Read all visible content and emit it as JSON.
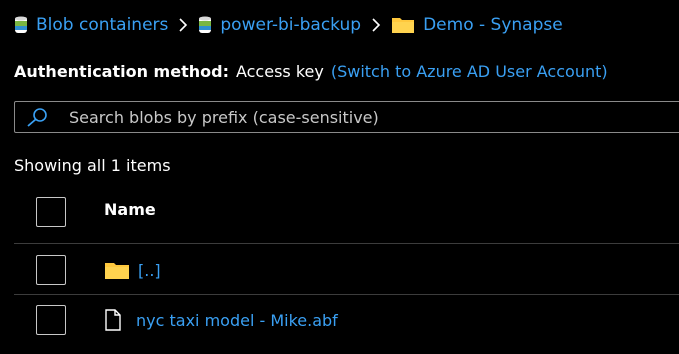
{
  "breadcrumb": {
    "items": [
      {
        "label": "Blob containers",
        "icon": "container-icon"
      },
      {
        "label": "power-bi-backup",
        "icon": "container-icon"
      },
      {
        "label": "Demo - Synapse",
        "icon": "folder-icon"
      }
    ],
    "separator": ">"
  },
  "auth": {
    "label": "Authentication method:",
    "value": "Access key",
    "link": "(Switch to Azure AD User Account)"
  },
  "search": {
    "placeholder": "Search blobs by prefix (case-sensitive)",
    "value": "",
    "icon": "search-icon"
  },
  "list": {
    "count_text": "Showing all 1 items",
    "column_header": "Name",
    "rows": [
      {
        "name": "[..]",
        "icon": "folder-icon"
      },
      {
        "name": "nyc taxi model - Mike.abf",
        "icon": "file-icon"
      }
    ]
  },
  "colors": {
    "background": "#000000",
    "link": "#3aa0f3",
    "text": "#ffffff",
    "folder": "#ffc83d",
    "border": "#8a8a8a",
    "divider": "#3c3c3c"
  }
}
